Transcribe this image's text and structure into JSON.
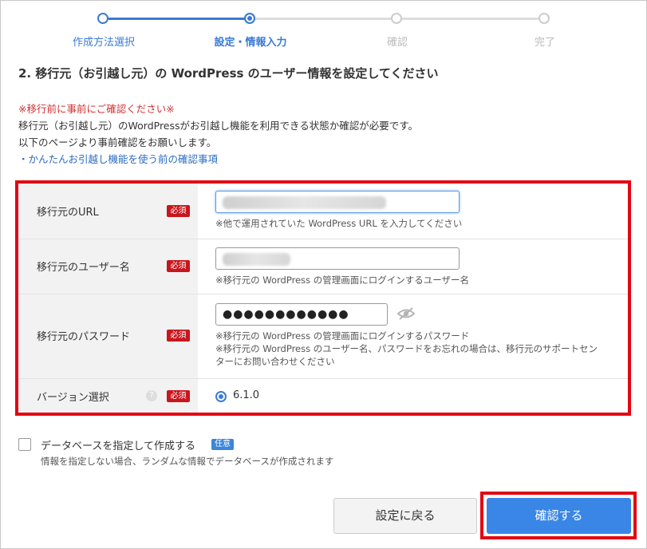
{
  "steps": [
    {
      "label": "作成方法選択",
      "state": "done"
    },
    {
      "label": "設定・情報入力",
      "state": "current"
    },
    {
      "label": "確認",
      "state": "todo"
    },
    {
      "label": "完了",
      "state": "todo"
    }
  ],
  "heading": "2. 移行元（お引越し元）の WordPress のユーザー情報を設定してください",
  "notice": {
    "warning": "※移行前に事前にご確認ください※",
    "line1": "移行元（お引越し元）のWordPressがお引越し機能を利用できる状態か確認が必要です。",
    "line2": "以下のページより事前確認をお願いします。",
    "link": "・かんたんお引越し機能を使う前の確認事項"
  },
  "form": {
    "required_badge": "必須",
    "url": {
      "label": "移行元のURL",
      "hint": "※他で運用されていた WordPress URL を入力してください"
    },
    "username": {
      "label": "移行元のユーザー名",
      "hint": "※移行元の WordPress の管理画面にログインするユーザー名"
    },
    "password": {
      "label": "移行元のパスワード",
      "value": "●●●●●●●●●●●●",
      "hint1": "※移行元の WordPress の管理画面にログインするパスワード",
      "hint2": "※移行元の WordPress のユーザー名、パスワードをお忘れの場合は、移行元のサポートセン",
      "hint3": "ターにお問い合わせください"
    },
    "version": {
      "label": "バージョン選択",
      "help_icon": "?",
      "selected": "6.1.0"
    }
  },
  "database": {
    "label": "データベースを指定して作成する",
    "optional_badge": "任意",
    "note": "情報を指定しない場合、ランダムな情報でデータベースが作成されます"
  },
  "buttons": {
    "back": "設定に戻る",
    "confirm": "確認する"
  },
  "colors": {
    "accent": "#3a7bd5",
    "required": "#c8161d",
    "highlight": "#e30613"
  }
}
